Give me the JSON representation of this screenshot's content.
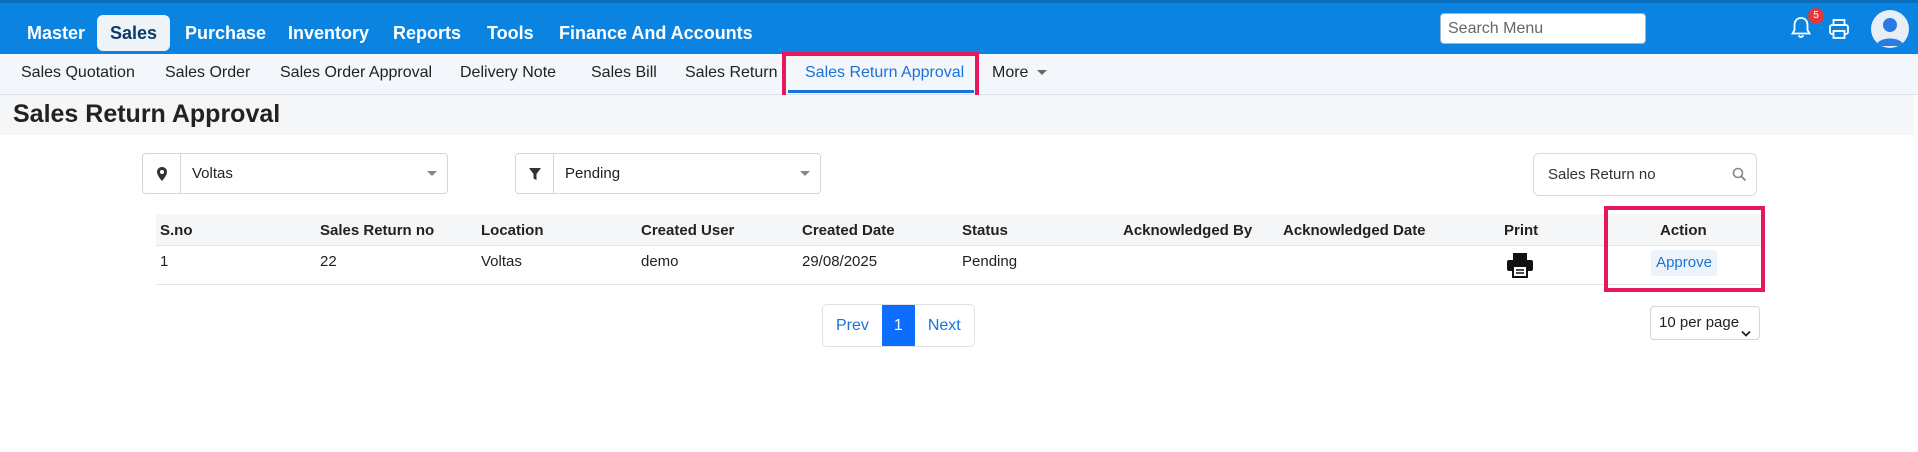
{
  "topnav": {
    "items": [
      {
        "label": "Master",
        "active": false
      },
      {
        "label": "Sales",
        "active": true
      },
      {
        "label": "Purchase",
        "active": false
      },
      {
        "label": "Inventory",
        "active": false
      },
      {
        "label": "Reports",
        "active": false
      },
      {
        "label": "Tools",
        "active": false
      },
      {
        "label": "Finance And Accounts",
        "active": false
      }
    ],
    "search_placeholder": "Search Menu",
    "notification_count": "5"
  },
  "subnav": {
    "tabs": [
      {
        "label": "Sales Quotation"
      },
      {
        "label": "Sales Order"
      },
      {
        "label": "Sales Order Approval"
      },
      {
        "label": "Delivery Note"
      },
      {
        "label": "Sales Bill"
      },
      {
        "label": "Sales Return"
      },
      {
        "label": "Sales Return Approval",
        "active": true
      },
      {
        "label": "More"
      }
    ]
  },
  "page": {
    "title": "Sales Return Approval"
  },
  "filters": {
    "location": "Voltas",
    "status": "Pending",
    "search_placeholder": "Sales Return no"
  },
  "table": {
    "headers": [
      "S.no",
      "Sales Return no",
      "Location",
      "Created User",
      "Created Date",
      "Status",
      "Acknowledged By",
      "Acknowledged Date",
      "Print",
      "Action"
    ],
    "rows": [
      {
        "sno": "1",
        "return_no": "22",
        "location": "Voltas",
        "created_user": "demo",
        "created_date": "29/08/2025",
        "status": "Pending",
        "ack_by": "",
        "ack_date": "",
        "action": "Approve"
      }
    ]
  },
  "pagination": {
    "prev": "Prev",
    "current": "1",
    "next": "Next",
    "per_page": "10 per page"
  },
  "colors": {
    "topbar": "#0a84e0",
    "accent": "#1a73d9",
    "highlight": "#e8175d"
  }
}
